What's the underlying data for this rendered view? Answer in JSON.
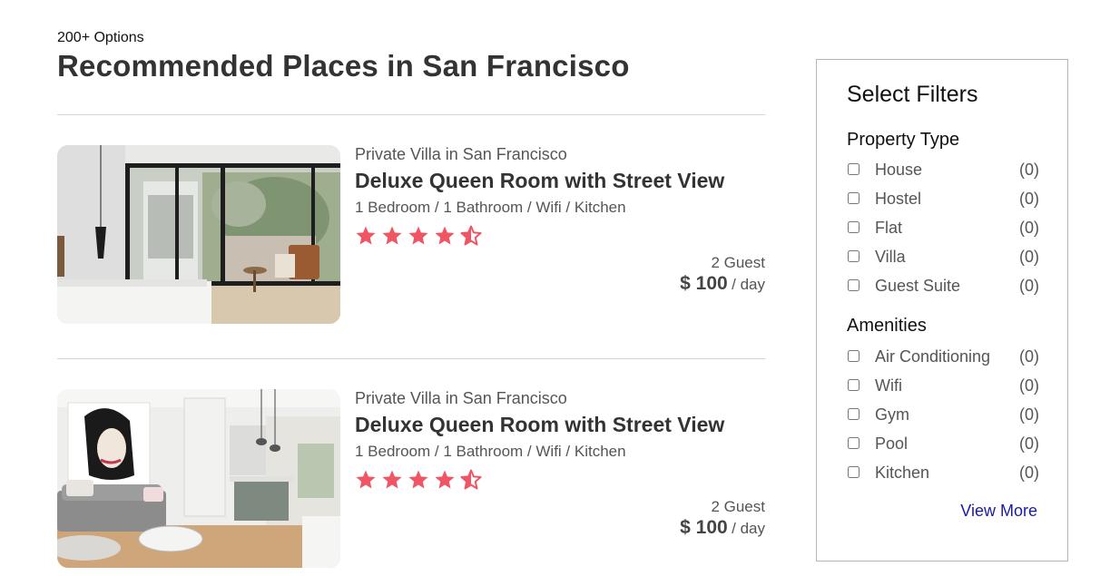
{
  "header": {
    "count": "200+ Options",
    "title": "Recommended Places in San Francisco"
  },
  "listings": [
    {
      "type": "Private Villa in San Francisco",
      "name": "Deluxe Queen Room with Street View",
      "amenities": "1 Bedroom / 1 Bathroom / Wifi / Kitchen",
      "rating": 4.5,
      "guests": "2 Guest",
      "price": "$ 100",
      "per": "/ day"
    },
    {
      "type": "Private Villa in San Francisco",
      "name": "Deluxe Queen Room with Street View",
      "amenities": "1 Bedroom / 1 Bathroom / Wifi / Kitchen",
      "rating": 4.5,
      "guests": "2 Guest",
      "price": "$ 100",
      "per": "/ day"
    }
  ],
  "filters": {
    "title": "Select Filters",
    "sections": [
      {
        "heading": "Property Type",
        "options": [
          {
            "label": "House",
            "count": "(0)"
          },
          {
            "label": "Hostel",
            "count": "(0)"
          },
          {
            "label": "Flat",
            "count": "(0)"
          },
          {
            "label": "Villa",
            "count": "(0)"
          },
          {
            "label": "Guest Suite",
            "count": "(0)"
          }
        ]
      },
      {
        "heading": "Amenities",
        "options": [
          {
            "label": "Air Conditioning",
            "count": "(0)"
          },
          {
            "label": "Wifi",
            "count": "(0)"
          },
          {
            "label": "Gym",
            "count": "(0)"
          },
          {
            "label": "Pool",
            "count": "(0)"
          },
          {
            "label": "Kitchen",
            "count": "(0)"
          }
        ]
      }
    ],
    "view_more": "View More"
  },
  "colors": {
    "star": "#f05563",
    "link": "#1a1aa6"
  },
  "icons": {
    "star": "star-icon",
    "half_star": "star-half-icon"
  }
}
